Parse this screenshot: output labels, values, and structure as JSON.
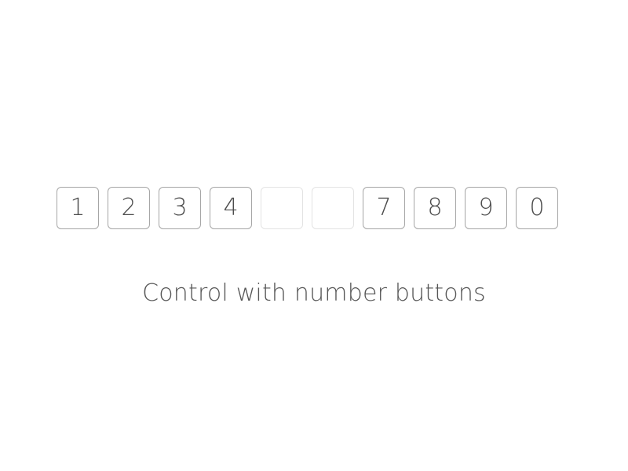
{
  "keypad": {
    "keys": [
      {
        "label": "1",
        "state": "normal"
      },
      {
        "label": "2",
        "state": "normal"
      },
      {
        "label": "3",
        "state": "normal"
      },
      {
        "label": "4",
        "state": "normal"
      },
      {
        "label": "",
        "state": "faded"
      },
      {
        "label": "",
        "state": "faded"
      },
      {
        "label": "7",
        "state": "normal"
      },
      {
        "label": "8",
        "state": "normal"
      },
      {
        "label": "9",
        "state": "normal"
      },
      {
        "label": "0",
        "state": "normal"
      }
    ]
  },
  "caption": "Control with number buttons",
  "colors": {
    "key_border": "#a6a6a6",
    "key_border_faded": "#e3e3e3",
    "text": "#4d4d4d",
    "background": "#ffffff"
  }
}
